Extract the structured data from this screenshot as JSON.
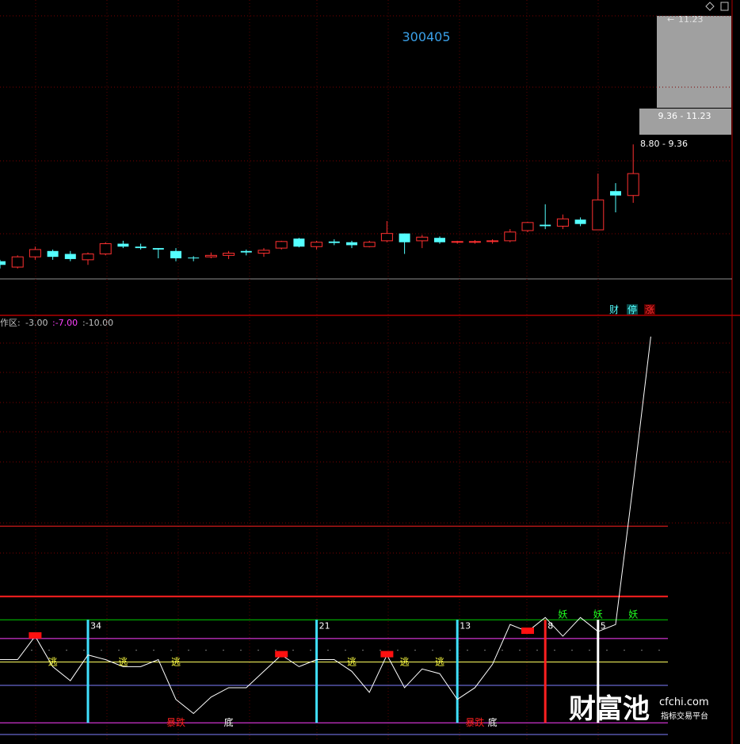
{
  "colors": {
    "up": "#ff3030",
    "down": "#54ffff",
    "grid": "#7a0000",
    "line": "#ffffff"
  },
  "header": {
    "code": "300405"
  },
  "price_panel": {
    "price_bands": [
      {
        "label": "9.36 - 11.23"
      },
      {
        "label": "8.80 - 9.36"
      }
    ],
    "band_top_label": "11.23",
    "badges": [
      {
        "text": "财",
        "color": "#54ffff"
      },
      {
        "text": "停",
        "color": "#54ffff"
      },
      {
        "text": "涨",
        "color": "#ff3030"
      }
    ]
  },
  "indicator_panel": {
    "legend": [
      {
        "text": "作区:",
        "color": "#c0c0c0"
      },
      {
        "text": "-3.00",
        "color": "#c0c0c0"
      },
      {
        "text": ":-7.00",
        "color": "#ff40ff"
      },
      {
        "text": ":-10.00",
        "color": "#c0c0c0"
      }
    ],
    "bar_labels": [
      "34",
      "21",
      "13",
      "8",
      "5"
    ],
    "escape_label": "逃",
    "crash_label": "暴跌",
    "bottom_label": "底",
    "monster_label": "妖"
  },
  "watermark": {
    "brand": "财富池",
    "site": "cfchi.com",
    "subtitle": "指标交易平台"
  },
  "chart_data": [
    {
      "type": "candlestick",
      "title": "300405",
      "series": [
        {
          "o": 6.6,
          "h": 6.62,
          "l": 6.5,
          "c": 6.55
        },
        {
          "o": 6.52,
          "h": 6.68,
          "l": 6.5,
          "c": 6.66
        },
        {
          "o": 6.66,
          "h": 6.8,
          "l": 6.62,
          "c": 6.76
        },
        {
          "o": 6.74,
          "h": 6.76,
          "l": 6.62,
          "c": 6.66
        },
        {
          "o": 6.7,
          "h": 6.74,
          "l": 6.6,
          "c": 6.63
        },
        {
          "o": 6.62,
          "h": 6.72,
          "l": 6.55,
          "c": 6.7
        },
        {
          "o": 6.7,
          "h": 6.86,
          "l": 6.68,
          "c": 6.84
        },
        {
          "o": 6.84,
          "h": 6.88,
          "l": 6.78,
          "c": 6.8
        },
        {
          "o": 6.8,
          "h": 6.84,
          "l": 6.76,
          "c": 6.78
        },
        {
          "o": 6.78,
          "h": 6.78,
          "l": 6.64,
          "c": 6.76
        },
        {
          "o": 6.74,
          "h": 6.78,
          "l": 6.6,
          "c": 6.64
        },
        {
          "o": 6.65,
          "h": 6.67,
          "l": 6.6,
          "c": 6.64
        },
        {
          "o": 6.66,
          "h": 6.72,
          "l": 6.64,
          "c": 6.68
        },
        {
          "o": 6.68,
          "h": 6.74,
          "l": 6.63,
          "c": 6.71
        },
        {
          "o": 6.74,
          "h": 6.76,
          "l": 6.68,
          "c": 6.72
        },
        {
          "o": 6.71,
          "h": 6.78,
          "l": 6.66,
          "c": 6.75
        },
        {
          "o": 6.78,
          "h": 6.88,
          "l": 6.76,
          "c": 6.87
        },
        {
          "o": 6.91,
          "h": 6.92,
          "l": 6.79,
          "c": 6.8
        },
        {
          "o": 6.8,
          "h": 6.88,
          "l": 6.76,
          "c": 6.86
        },
        {
          "o": 6.87,
          "h": 6.9,
          "l": 6.82,
          "c": 6.85
        },
        {
          "o": 6.86,
          "h": 6.88,
          "l": 6.78,
          "c": 6.82
        },
        {
          "o": 6.8,
          "h": 6.88,
          "l": 6.79,
          "c": 6.86
        },
        {
          "o": 6.88,
          "h": 7.15,
          "l": 6.86,
          "c": 6.98
        },
        {
          "o": 6.98,
          "h": 6.98,
          "l": 6.7,
          "c": 6.86
        },
        {
          "o": 6.88,
          "h": 6.96,
          "l": 6.78,
          "c": 6.93
        },
        {
          "o": 6.92,
          "h": 6.94,
          "l": 6.84,
          "c": 6.86
        },
        {
          "o": 6.86,
          "h": 6.88,
          "l": 6.84,
          "c": 6.87
        },
        {
          "o": 6.86,
          "h": 6.89,
          "l": 6.84,
          "c": 6.87
        },
        {
          "o": 6.87,
          "h": 6.9,
          "l": 6.84,
          "c": 6.88
        },
        {
          "o": 6.88,
          "h": 7.04,
          "l": 6.86,
          "c": 7.0
        },
        {
          "o": 7.02,
          "h": 7.14,
          "l": 7.0,
          "c": 7.13
        },
        {
          "o": 7.1,
          "h": 7.38,
          "l": 7.04,
          "c": 7.08
        },
        {
          "o": 7.08,
          "h": 7.24,
          "l": 7.04,
          "c": 7.18
        },
        {
          "o": 7.17,
          "h": 7.2,
          "l": 7.08,
          "c": 7.11
        },
        {
          "o": 7.03,
          "h": 7.8,
          "l": 7.03,
          "c": 7.44
        },
        {
          "o": 7.56,
          "h": 7.67,
          "l": 7.27,
          "c": 7.5
        },
        {
          "o": 7.5,
          "h": 8.2,
          "l": 7.4,
          "c": 7.8
        }
      ],
      "ylim": [
        6.0,
        9.96
      ]
    },
    {
      "type": "line",
      "name": "indicator",
      "values": [
        2.7,
        2.7,
        3.7,
        2.4,
        1.8,
        2.9,
        2.7,
        2.4,
        2.4,
        2.7,
        1.0,
        0.4,
        1.1,
        1.5,
        1.5,
        2.2,
        2.9,
        2.4,
        2.7,
        2.7,
        2.2,
        1.3,
        2.9,
        1.5,
        2.3,
        2.1,
        1.0,
        1.5,
        2.5,
        4.2,
        3.9,
        4.5,
        3.7,
        4.5,
        3.9,
        4.2,
        10.2,
        16.5
      ],
      "ylim": [
        -0.6,
        17.0
      ],
      "reference_lines": [
        {
          "value": 4.4,
          "color": "#00d000"
        },
        {
          "value": 3.6,
          "color": "#ff40ff"
        },
        {
          "value": 2.6,
          "color": "#ffff60"
        },
        {
          "value": 1.6,
          "color": "#8080ff"
        },
        {
          "value": 0.0,
          "color": "#ff40ff"
        },
        {
          "value": 5.4,
          "color": "#ff2020"
        },
        {
          "value": 8.4,
          "color": "#ff2020"
        }
      ],
      "markers": [
        {
          "kind": "escape",
          "at": 3
        },
        {
          "kind": "escape",
          "at": 7
        },
        {
          "kind": "escape",
          "at": 10
        },
        {
          "kind": "escape",
          "at": 20
        },
        {
          "kind": "escape",
          "at": 23
        },
        {
          "kind": "escape",
          "at": 25
        },
        {
          "kind": "crash",
          "at": 10
        },
        {
          "kind": "bottom",
          "at": 13
        },
        {
          "kind": "crash",
          "at": 27
        },
        {
          "kind": "bottom",
          "at": 28
        },
        {
          "kind": "monster",
          "at": 32
        },
        {
          "kind": "monster",
          "at": 34
        },
        {
          "kind": "monster",
          "at": 36
        },
        {
          "kind": "peak",
          "at": 2
        },
        {
          "kind": "peak",
          "at": 16
        },
        {
          "kind": "peak",
          "at": 22
        },
        {
          "kind": "peak",
          "at": 30
        }
      ],
      "bars": [
        {
          "at": 5,
          "label": "34",
          "color": "#40e0ff"
        },
        {
          "at": 18,
          "label": "21",
          "color": "#40e0ff"
        },
        {
          "at": 26,
          "label": "13",
          "color": "#40e0ff"
        },
        {
          "at": 31,
          "label": "8",
          "color": "#ff2020"
        },
        {
          "at": 34,
          "label": "5",
          "color": "#ffffff"
        }
      ]
    }
  ]
}
